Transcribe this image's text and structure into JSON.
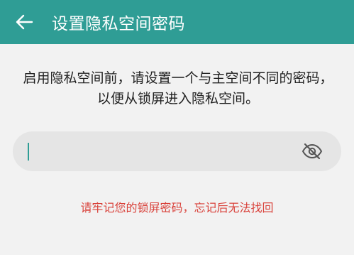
{
  "header": {
    "title": "设置隐私空间密码",
    "back_icon": "arrow-left-icon",
    "background_color": "#2f9d95"
  },
  "main": {
    "instruction": "启用隐私空间前，请设置一个与主空间不同的密码，以便从锁屏进入隐私空间。",
    "password_field": {
      "value": "",
      "placeholder": "",
      "visibility_icon": "eye-off-icon"
    },
    "warning": "请牢记您的锁屏密码，忘记后无法找回",
    "warning_color": "#d9423b"
  }
}
